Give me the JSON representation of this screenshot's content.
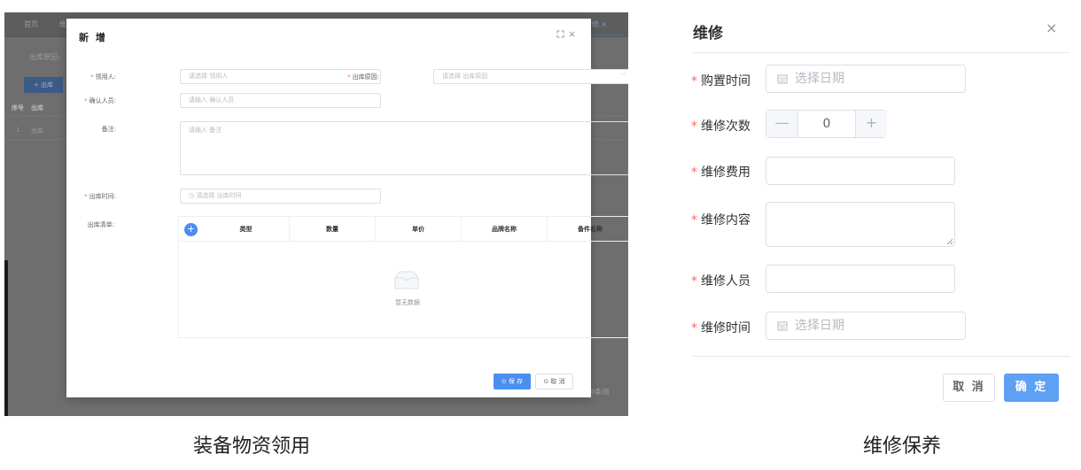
{
  "left": {
    "background": {
      "tabs": [
        "首页",
        "维"
      ],
      "active_tab": "修 ×",
      "filter_label": "出库原因:",
      "action_button": "+ 出库",
      "table_headers": [
        "序号",
        "出库"
      ],
      "row": [
        "1",
        "出库"
      ],
      "pager": "0条/页"
    },
    "modal": {
      "title": "新 增",
      "close_glyph": "×",
      "required_mark": "*",
      "fields": {
        "receiver": {
          "label": "领用人:",
          "placeholder": "请选择 领用人"
        },
        "reason": {
          "label": "出库原因:",
          "placeholder": "请选择 出库原因"
        },
        "confirmer": {
          "label": "确认人员:",
          "placeholder": "请输入 确认人员"
        },
        "remark": {
          "label": "备注:",
          "placeholder": "请输入 备注"
        },
        "time": {
          "label": "出库时间:",
          "placeholder": "请选择 出库时间"
        },
        "list": {
          "label": "出库清单:"
        }
      },
      "table": {
        "add_glyph": "+",
        "columns": [
          "类型",
          "数量",
          "单价",
          "品牌名称",
          "备件名称"
        ],
        "empty_text": "暂无数据"
      },
      "buttons": {
        "save": "⊙ 保 存",
        "cancel": "⊙ 取 消"
      },
      "accent_color": "#4a8ef0"
    }
  },
  "right": {
    "title": "维修",
    "close_glyph": "×",
    "required_mark": "*",
    "fields": {
      "purchase_time": {
        "label": "购置时间",
        "placeholder": "选择日期"
      },
      "repair_count": {
        "label": "维修次数",
        "value": "0",
        "minus": "—",
        "plus": "+"
      },
      "repair_cost": {
        "label": "维修费用"
      },
      "repair_content": {
        "label": "维修内容"
      },
      "repair_staff": {
        "label": "维修人员"
      },
      "repair_time": {
        "label": "维修时间",
        "placeholder": "选择日期"
      }
    },
    "buttons": {
      "cancel": "取 消",
      "confirm": "确 定"
    },
    "accent_color": "#5ea0f3"
  },
  "captions": {
    "left": "装备物资领用",
    "right": "维修保养"
  }
}
